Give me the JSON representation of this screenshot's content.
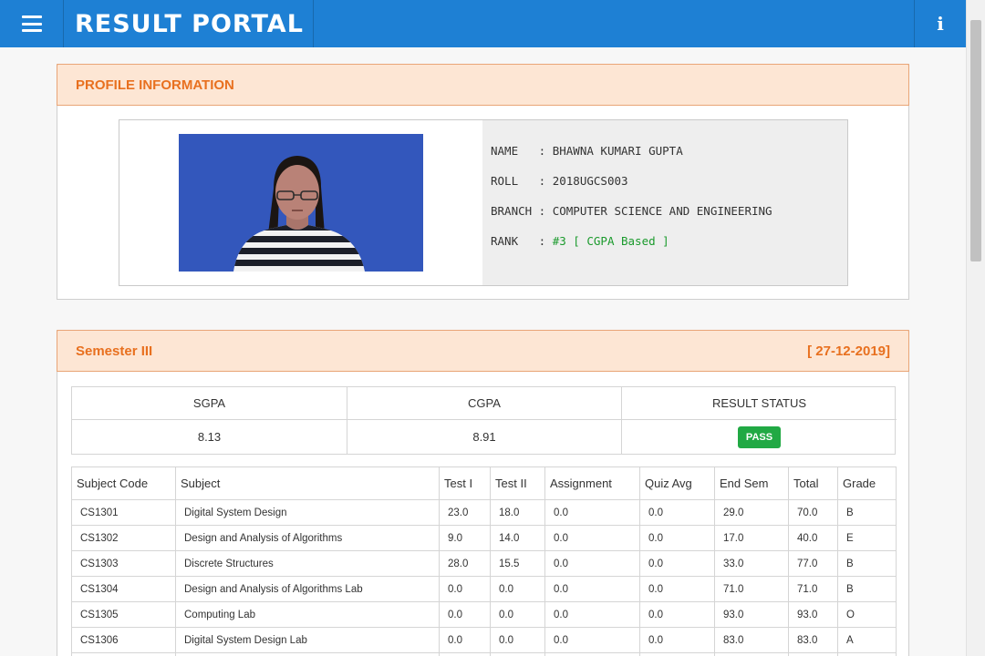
{
  "app": {
    "title": "RESULT PORTAL"
  },
  "profile": {
    "header": "PROFILE INFORMATION",
    "fields": [
      {
        "key": "NAME  ",
        "value": "BHAWNA KUMARI GUPTA"
      },
      {
        "key": "ROLL  ",
        "value": "2018UGCS003"
      },
      {
        "key": "BRANCH",
        "value": "COMPUTER SCIENCE AND ENGINEERING"
      },
      {
        "key": "RANK  ",
        "value": "#3 [ CGPA Based ]"
      }
    ],
    "separator": " : "
  },
  "semester": {
    "title": "Semester III",
    "date": "[ 27-12-2019]",
    "summary": {
      "headers": [
        "SGPA",
        "CGPA",
        "RESULT STATUS"
      ],
      "sgpa": "8.13",
      "cgpa": "8.91",
      "status": "PASS",
      "status_color": "#21a944"
    },
    "table": {
      "headers": [
        "Subject Code",
        "Subject",
        "Test I",
        "Test II",
        "Assignment",
        "Quiz Avg",
        "End Sem",
        "Total",
        "Grade"
      ],
      "rows": [
        [
          "CS1301",
          "Digital System Design",
          "23.0",
          "18.0",
          "0.0",
          "0.0",
          "29.0",
          "70.0",
          "B"
        ],
        [
          "CS1302",
          "Design and Analysis of Algorithms",
          "9.0",
          "14.0",
          "0.0",
          "0.0",
          "17.0",
          "40.0",
          "E"
        ],
        [
          "CS1303",
          "Discrete Structures",
          "28.0",
          "15.5",
          "0.0",
          "0.0",
          "33.0",
          "77.0",
          "B"
        ],
        [
          "CS1304",
          "Design and Analysis of Algorithms Lab",
          "0.0",
          "0.0",
          "0.0",
          "0.0",
          "71.0",
          "71.0",
          "B"
        ],
        [
          "CS1305",
          "Computing Lab",
          "0.0",
          "0.0",
          "0.0",
          "0.0",
          "93.0",
          "93.0",
          "O"
        ],
        [
          "CS1306",
          "Digital System Design Lab",
          "0.0",
          "0.0",
          "0.0",
          "0.0",
          "83.0",
          "83.0",
          "A"
        ],
        [
          "",
          "",
          "",
          "",
          "",
          "",
          "",
          "",
          ""
        ]
      ]
    }
  },
  "icons": {
    "menu": "hamburger-menu-icon",
    "info": "info-icon"
  },
  "colors": {
    "topbar": "#1e80d4",
    "panel_head_bg": "#fde6d4",
    "panel_head_text": "#e8701f",
    "rank": "#1a9a2c"
  }
}
